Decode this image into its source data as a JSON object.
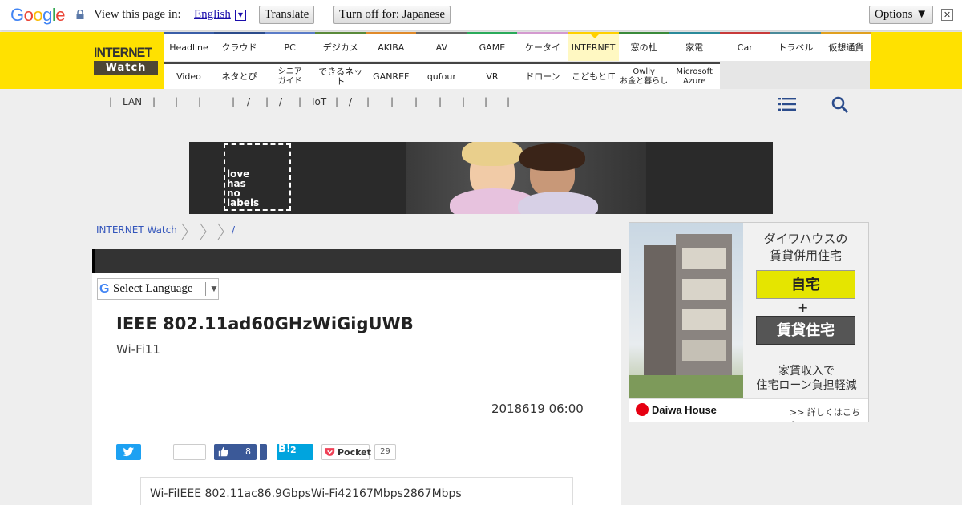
{
  "translate_bar": {
    "logo": "Google",
    "view_text": "View this page in:",
    "language": "English",
    "translate_btn": "Translate",
    "turn_off_btn": "Turn off for: Japanese",
    "options_btn": "Options ▼",
    "close": "✕"
  },
  "site": {
    "logo_top": "INTERNET",
    "logo_bottom": "Watch",
    "nav_row1": [
      {
        "label": "Headline",
        "color": "#3a5ea8"
      },
      {
        "label": "クラウド",
        "color": "#2c4c8c"
      },
      {
        "label": "PC",
        "color": "#5b7cc8"
      },
      {
        "label": "デジカメ",
        "color": "#5a8a3a"
      },
      {
        "label": "AKIBA",
        "color": "#e08a2a"
      },
      {
        "label": "AV",
        "color": "#666666"
      },
      {
        "label": "GAME",
        "color": "#2aaa5a"
      },
      {
        "label": "ケータイ",
        "color": "#d49ad0"
      },
      {
        "label": "INTERNET",
        "color": "#ffd000"
      },
      {
        "label": "窓の杜",
        "color": "#3a8a3a"
      },
      {
        "label": "家電",
        "color": "#2a8a9a"
      },
      {
        "label": "Car",
        "color": "#c83a3a"
      },
      {
        "label": "トラベル",
        "color": "#4a8a9a"
      },
      {
        "label": "仮想通貨",
        "color": "#e0a020"
      }
    ],
    "nav_row2": [
      "Video",
      "ネタとぴ",
      "シニアガイド",
      "できるネット",
      "GANREF",
      "qufour",
      "VR",
      "ドローン",
      "こどもとIT",
      "Owllyお金と暮らし",
      "MicrosoftAzure"
    ],
    "nav_row2_lines": [
      [
        "Video"
      ],
      [
        "ネタとぴ"
      ],
      [
        "シニア",
        "ガイド"
      ],
      [
        "できるネット"
      ],
      [
        "GANREF"
      ],
      [
        "qufour"
      ],
      [
        "VR"
      ],
      [
        "ドローン"
      ],
      [
        "こどもとIT"
      ],
      [
        "Owlly",
        "お金と暮らし"
      ],
      [
        "Microsoft",
        "Azure"
      ]
    ],
    "subnav": [
      "LAN",
      "/",
      "/",
      "IoT",
      "/"
    ]
  },
  "banner": {
    "text": "love has no labels"
  },
  "breadcrumb": {
    "home": "INTERNET Watch",
    "slash": "/"
  },
  "translate_widget": {
    "label": "Select Language"
  },
  "article": {
    "title": "IEEE 802.11ad60GHzWiGigUWB",
    "subtitle": "Wi-Fi11",
    "date": "2018619 06:00",
    "fb_count": "8",
    "hatena_count": "2",
    "pocket_label": "Pocket",
    "pocket_count": "29",
    "lead": "Wi-FiIEEE 802.11ac86.9GbpsWi-Fi42167Mbps2867Mbps"
  },
  "ad": {
    "headline": "ダイワハウスの賃貸併用住宅",
    "headline_lines": [
      "ダイワハウスの",
      "賃貸併用住宅"
    ],
    "btn1": "自宅",
    "plus": "+",
    "btn2": "賃貸住宅",
    "body_lines": [
      "家賃収入で",
      "住宅ローン負担軽減"
    ],
    "brand": "Daiwa House",
    "more": ">> 詳しくはこちら"
  }
}
